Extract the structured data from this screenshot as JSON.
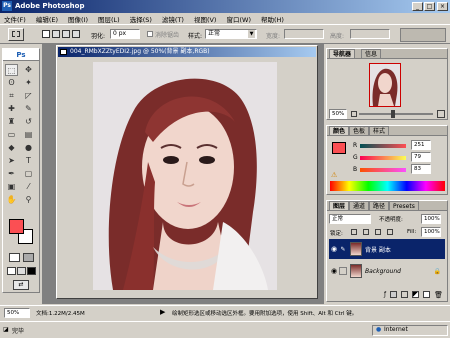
{
  "app": {
    "title": "Adobe Photoshop",
    "window_buttons": [
      "_",
      "□",
      "×"
    ]
  },
  "menu": [
    "文件(F)",
    "编辑(E)",
    "图像(I)",
    "图层(L)",
    "选择(S)",
    "滤镜(T)",
    "视图(V)",
    "窗口(W)",
    "帮助(H)"
  ],
  "options": {
    "feather_label": "羽化:",
    "feather_value": "0 px",
    "antialias_label": "消除锯齿",
    "style_label": "样式:",
    "style_value": "正常",
    "width_label": "宽度:",
    "height_label": "高度:"
  },
  "document": {
    "title": "004_RMbXZZtyEDI2.jpg @ 50%(背景 副本,RGB)"
  },
  "navigator": {
    "tabs": [
      "导航器",
      "信息"
    ],
    "zoom": "50%"
  },
  "color_panel": {
    "tabs": [
      "颜色",
      "色板",
      "样式"
    ],
    "channels": [
      {
        "label": "R",
        "value": "251"
      },
      {
        "label": "G",
        "value": "79"
      },
      {
        "label": "B",
        "value": "83"
      }
    ],
    "fg_color": "#fb4f53"
  },
  "layers_panel": {
    "tabs": [
      "图层",
      "通道",
      "路径",
      "Presets"
    ],
    "blend_mode": "正常",
    "opacity_label": "不透明度:",
    "opacity_value": "100%",
    "lock_label": "锁定:",
    "fill_label": "Fill:",
    "fill_value": "100%",
    "layers": [
      {
        "name": "背景 副本",
        "selected": true
      },
      {
        "name": "Background",
        "selected": false
      }
    ]
  },
  "status": {
    "zoom": "50%",
    "doc_info": "文档:1.22M/2.45M",
    "hint": "绘制矩形选区或移动选区外框。要用附加选项，使用 Shift、Alt 和 Ctrl 键。"
  },
  "taskbar": {
    "left": "完毕",
    "right": "Internet"
  }
}
